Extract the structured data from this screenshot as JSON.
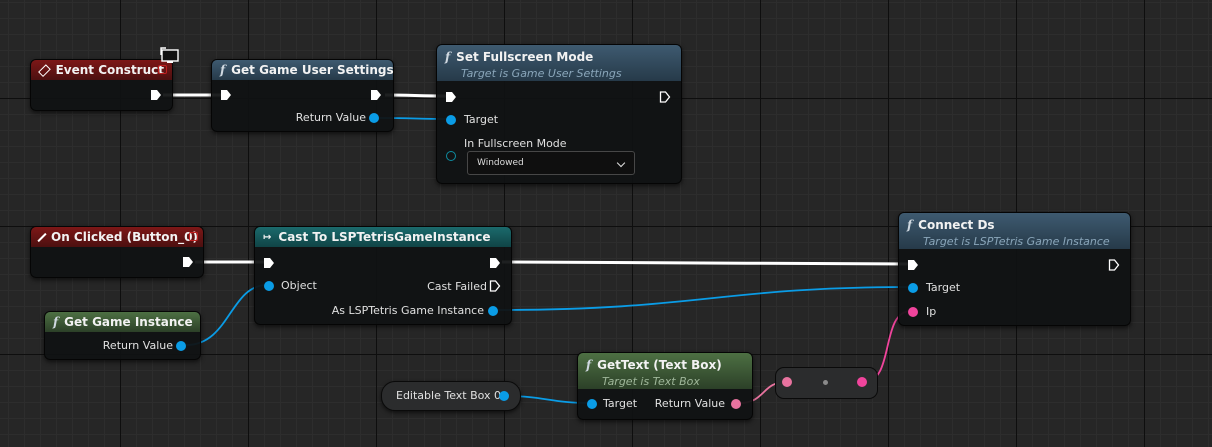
{
  "graph": {
    "event_construct": {
      "title": "Event Construct"
    },
    "get_game_user_settings": {
      "title": "Get Game User Settings",
      "return_label": "Return Value"
    },
    "set_fullscreen": {
      "title": "Set Fullscreen Mode",
      "subtitle": "Target is Game User Settings",
      "target_label": "Target",
      "mode_label": "In Fullscreen Mode",
      "mode_value": "Windowed"
    },
    "on_clicked": {
      "title": "On Clicked (Button_0)"
    },
    "cast": {
      "title": "Cast To LSPTetrisGameInstance",
      "object_label": "Object",
      "cast_failed_label": "Cast Failed",
      "as_label": "As LSPTetris Game Instance"
    },
    "connect_ds": {
      "title": "Connect Ds",
      "subtitle": "Target is LSPTetris Game Instance",
      "target_label": "Target",
      "ip_label": "Ip"
    },
    "get_game_instance": {
      "title": "Get Game Instance",
      "return_label": "Return Value"
    },
    "editable_text_box": {
      "label": "Editable Text Box 0"
    },
    "get_text": {
      "title": "GetText (Text Box)",
      "subtitle": "Target is Text Box",
      "target_label": "Target",
      "return_label": "Return Value"
    }
  },
  "function_glyph": "f",
  "colors": {
    "exec_wire": "#ffffff",
    "object_pin": "#0a9ce6",
    "string_pin": "#f0449c",
    "text_pin": "#e8739f",
    "event_header": "#7d1717",
    "function_header": "#3e5a70",
    "pure_function_header": "#4d7043",
    "cast_header": "#1b6a6c"
  },
  "icons": [
    "event-diamond-icon",
    "function-icon",
    "cast-icon",
    "exec-pin-icon",
    "delegate-pin-icon",
    "monitor-icon",
    "chevron-down-icon"
  ]
}
